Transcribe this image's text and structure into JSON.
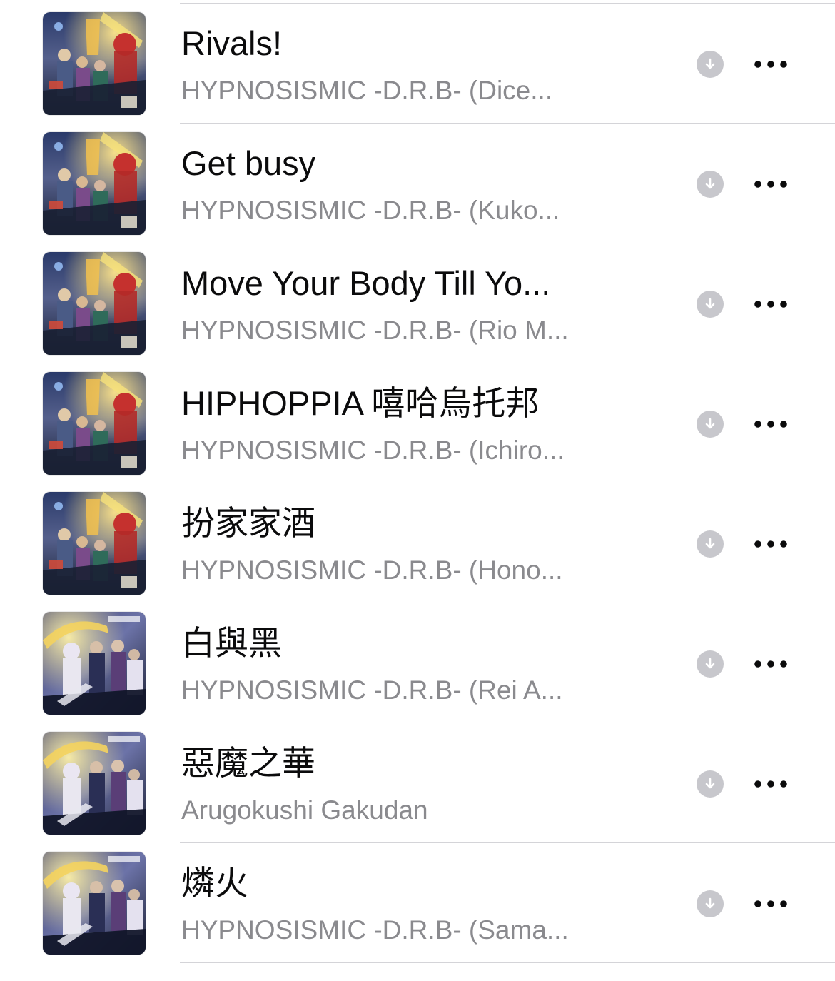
{
  "songs": [
    {
      "title": "Rivals!",
      "artist": "HYPNOSISMIC -D.R.B- (Dice...",
      "artwork_style": "album-a",
      "artwork_icon": "album-art"
    },
    {
      "title": "Get busy",
      "artist": "HYPNOSISMIC -D.R.B- (Kuko...",
      "artwork_style": "album-a",
      "artwork_icon": "album-art"
    },
    {
      "title": "Move Your Body Till Yo...",
      "artist": "HYPNOSISMIC -D.R.B- (Rio M...",
      "artwork_style": "album-a",
      "artwork_icon": "album-art"
    },
    {
      "title": "HIPHOPPIA 嘻哈烏托邦",
      "artist": "HYPNOSISMIC -D.R.B- (Ichiro...",
      "artwork_style": "album-a",
      "artwork_icon": "album-art"
    },
    {
      "title": "扮家家酒",
      "artist": "HYPNOSISMIC -D.R.B- (Hono...",
      "artwork_style": "album-a",
      "artwork_icon": "album-art"
    },
    {
      "title": "白與黑",
      "artist": "HYPNOSISMIC -D.R.B- (Rei A...",
      "artwork_style": "album-b",
      "artwork_icon": "album-art"
    },
    {
      "title": "惡魔之華",
      "artist": "Arugokushi Gakudan",
      "artwork_style": "album-b",
      "artwork_icon": "album-art"
    },
    {
      "title": "燐火",
      "artist": "HYPNOSISMIC -D.R.B- (Sama...",
      "artwork_style": "album-b",
      "artwork_icon": "album-art"
    }
  ],
  "icons": {
    "download": "download-icon",
    "more": "more-icon"
  },
  "colors": {
    "title_text": "#0b0b0c",
    "subtitle_text": "#8a8a8e",
    "download_circle": "#c7c7cc",
    "more_dots": "#0b0b0c",
    "divider": "#d4d4d8"
  }
}
